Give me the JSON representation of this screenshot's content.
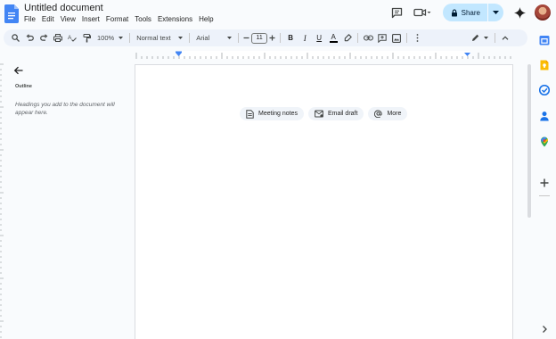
{
  "doc": {
    "title": "Untitled document"
  },
  "menu": [
    "File",
    "Edit",
    "View",
    "Insert",
    "Format",
    "Tools",
    "Extensions",
    "Help"
  ],
  "share": {
    "label": "Share"
  },
  "toolbar": {
    "zoom": "100%",
    "style": "Normal text",
    "font": "Arial",
    "font_size": "11",
    "bold": "B",
    "italic": "I",
    "underline": "U",
    "text_color": "A"
  },
  "outline": {
    "title": "Outline",
    "hint": "Headings you add to the document will appear here."
  },
  "chips": [
    {
      "label": "Meeting notes",
      "icon": "doc-note-icon"
    },
    {
      "label": "Email draft",
      "icon": "email-icon"
    },
    {
      "label": "More",
      "icon": "at-sign-icon"
    }
  ],
  "colors": {
    "accent": "#0b57d0",
    "share_bg": "#c2e7ff",
    "toolbar_bg": "#edf2fa",
    "canvas_bg": "#f9fbfd"
  }
}
